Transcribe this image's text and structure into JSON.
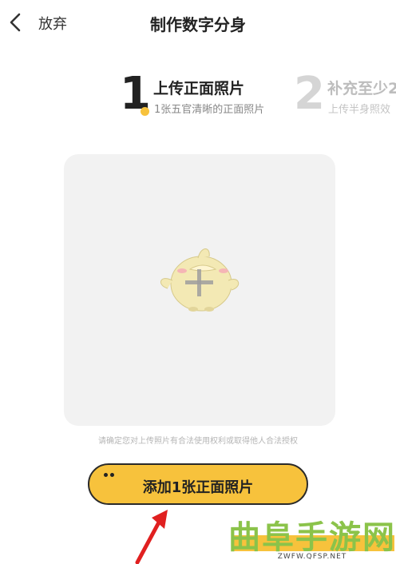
{
  "header": {
    "back_label": "放弃",
    "title": "制作数字分身"
  },
  "steps": [
    {
      "number": "1",
      "title": "上传正面照片",
      "subtitle": "1张五官清晰的正面照片",
      "active": true
    },
    {
      "number": "2",
      "title": "补充至少2",
      "subtitle": "上传半身照效",
      "active": false
    }
  ],
  "upload": {
    "icon": "plus-icon",
    "notice": "请确定您对上传照片有合法使用权利或取得他人合法授权"
  },
  "button": {
    "label": "添加1张正面照片"
  },
  "watermark": {
    "title": "曲阜手游网",
    "url": "ZWFW.QFSP.NET"
  },
  "colors": {
    "accent": "#f7c23c",
    "watermark_green": "#8bc34a",
    "arrow_red": "#e02020"
  }
}
